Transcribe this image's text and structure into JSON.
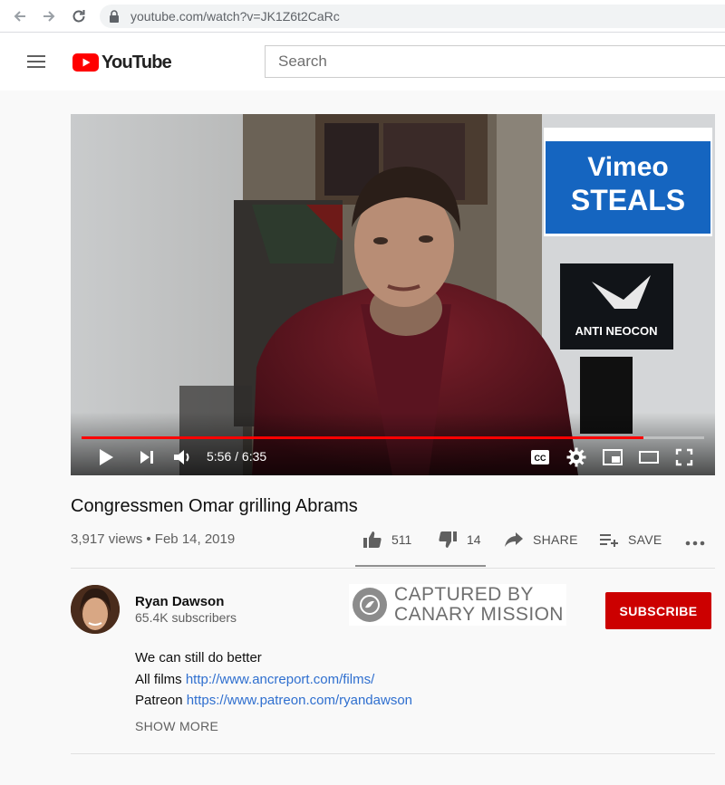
{
  "browser": {
    "url": "youtube.com/watch?v=JK1Z6t2CaRc"
  },
  "header": {
    "logo_text": "YouTube",
    "search_placeholder": "Search"
  },
  "player": {
    "time_display": "5:56 / 6:35",
    "progress_fraction": 0.902,
    "in_video_sign_line1": "Vimeo",
    "in_video_sign_line2": "STEALS",
    "in_video_poster_text": "ANTI NEOCON"
  },
  "video": {
    "title": "Congressmen Omar grilling Abrams",
    "meta": "3,917 views • Feb 14, 2019",
    "likes": "511",
    "dislikes": "14",
    "share_label": "SHARE",
    "save_label": "SAVE"
  },
  "channel": {
    "name": "Ryan Dawson",
    "subscribers": "65.4K subscribers",
    "subscribe_label": "SUBSCRIBE"
  },
  "watermark": {
    "line1": "CAPTURED BY",
    "line2": "CANARY MISSION"
  },
  "description": {
    "line1": "We can still do better",
    "films_label": "All films ",
    "films_url": "http://www.ancreport.com/films/",
    "patreon_label": "Patreon ",
    "patreon_url": "https://www.patreon.com/ryandawson",
    "show_more": "SHOW MORE"
  },
  "colors": {
    "youtube_red": "#ff0000",
    "subscribe_red": "#cc0000",
    "link_blue": "#2f6fcf"
  }
}
